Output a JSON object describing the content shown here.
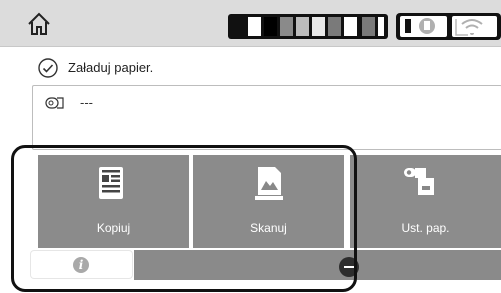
{
  "message": {
    "text": "Załaduj papier."
  },
  "paper": {
    "value": "---"
  },
  "tiles": [
    {
      "label": "Kopiuj"
    },
    {
      "label": "Skanuj"
    },
    {
      "label": "Ust. pap."
    }
  ],
  "icons": {
    "home": "home-icon",
    "ink": "ink-levels-icon",
    "printer_info": "printer-info-icon",
    "wifi": "wifi-icon",
    "check": "check-circle-icon",
    "roll": "paper-roll-icon",
    "copy": "copy-icon",
    "scan": "scan-icon",
    "paper_settings": "paper-settings-icon",
    "info": "info-icon",
    "minus": "minus-icon"
  },
  "colors": {
    "topbar": "#dcdcdc",
    "tile": "#8b8b8b",
    "frame": "#111111"
  }
}
